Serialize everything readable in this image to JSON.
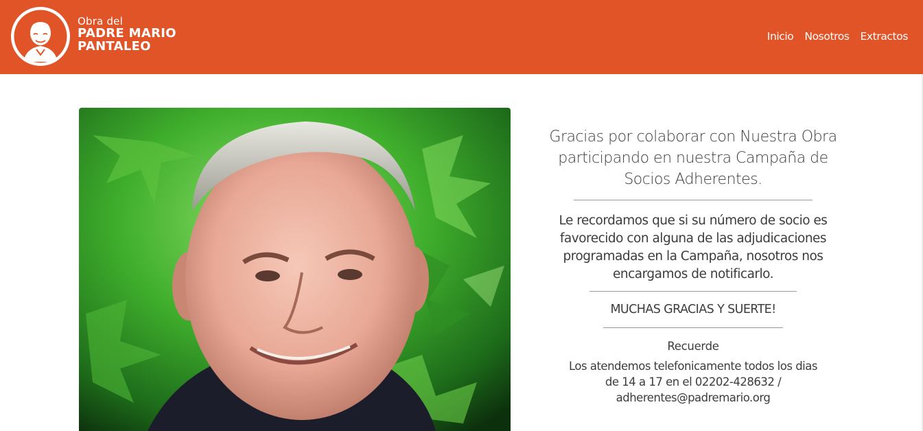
{
  "colors": {
    "brand": "#e05427",
    "text": "#3c3c3c",
    "divider": "#9a9a9a"
  },
  "header": {
    "logo": {
      "icon": "priest-portrait-logo-icon",
      "line_small": "Obra del",
      "line_big_1": "PADRE MARIO",
      "line_big_2": "PANTALEO"
    },
    "nav": [
      {
        "label": "Inicio"
      },
      {
        "label": "Nosotros"
      },
      {
        "label": "Extractos"
      }
    ]
  },
  "main": {
    "photo": {
      "subject": "portrait-photo"
    },
    "headline": "Gracias por colaborar con Nuestra Obra participando en nuestra Campaña de Socios Adherentes.",
    "reminder": "Le recordamos que si su número de socio es favorecido con alguna de las adjudicaciones programadas en la Campaña, nosotros nos encargamos de notificarlo.",
    "thanks": "MUCHAS GRACIAS Y SUERTE!",
    "remember_label": "Recuerde",
    "contact_line_1": "Los atendemos telefonicamente todos los dias",
    "contact_line_2": "de 14 a 17 en el 02202-428632 /",
    "contact_email": "adherentes@padremario.org"
  }
}
